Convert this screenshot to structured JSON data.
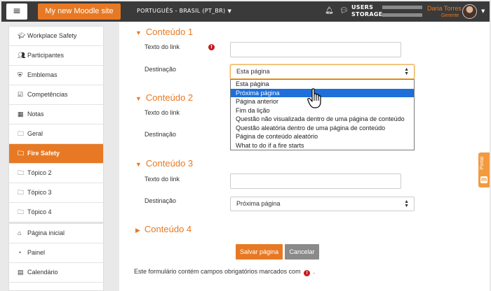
{
  "topnav": {
    "menu_icon": "hamburger-icon",
    "site_name": "My new Moodle site",
    "language": "PORTUGUÊS - BRASIL (PT_BR)",
    "users_label_1": "USERS",
    "users_label_2": "STORAGE",
    "user_name": "Daria Torres",
    "user_role": "Gerente"
  },
  "sidebar": {
    "group1": [
      {
        "label": "Workplace Safety",
        "icon": "graduation-cap-icon"
      },
      {
        "label": "Participantes",
        "icon": "users-icon"
      },
      {
        "label": "Emblemas",
        "icon": "shield-icon"
      },
      {
        "label": "Competências",
        "icon": "check-square-icon"
      },
      {
        "label": "Notas",
        "icon": "table-icon"
      },
      {
        "label": "Geral",
        "icon": "folder-icon"
      },
      {
        "label": "Fire Safety",
        "icon": "folder-icon",
        "active": true
      },
      {
        "label": "Tópico 2",
        "icon": "folder-icon"
      },
      {
        "label": "Tópico 3",
        "icon": "folder-icon"
      },
      {
        "label": "Tópico 4",
        "icon": "folder-icon"
      }
    ],
    "group2": [
      {
        "label": "Página inicial",
        "icon": "home-icon"
      },
      {
        "label": "Painel",
        "icon": "dashboard-icon"
      },
      {
        "label": "Calendário",
        "icon": "calendar-icon"
      }
    ]
  },
  "form": {
    "sections": [
      {
        "title": "Conteúdo 1",
        "link_label": "Texto do link",
        "dest_label": "Destinação",
        "dest_value": "Esta página"
      },
      {
        "title": "Conteúdo 2",
        "link_label": "Texto do link",
        "dest_label": "Destinação"
      },
      {
        "title": "Conteúdo 3",
        "link_label": "Texto do link",
        "dest_label": "Destinação",
        "dest_value": "Próxima página"
      },
      {
        "title": "Conteúdo 4"
      }
    ],
    "dropdown_options": [
      "Esta página",
      "Próxima página",
      "Página anterior",
      "Fim da lição",
      "Questão não visualizada dentro de uma página de conteúdo",
      "Questão aleatória dentro de uma página de conteúdo",
      "Página de conteúdo aleatório",
      "What to do if a fire starts"
    ],
    "highlighted_option": "Próxima página",
    "save_label": "Salvar página",
    "cancel_label": "Cancelar",
    "footnote": "Este formulário contém campos obrigatórios marcados com",
    "footnote_end": "."
  },
  "portal_tab": {
    "label": "Portal"
  },
  "colors": {
    "brand": "#e77924",
    "nav": "#3a3a3a",
    "highlight": "#1e6fd9",
    "required": "#c8181d"
  }
}
